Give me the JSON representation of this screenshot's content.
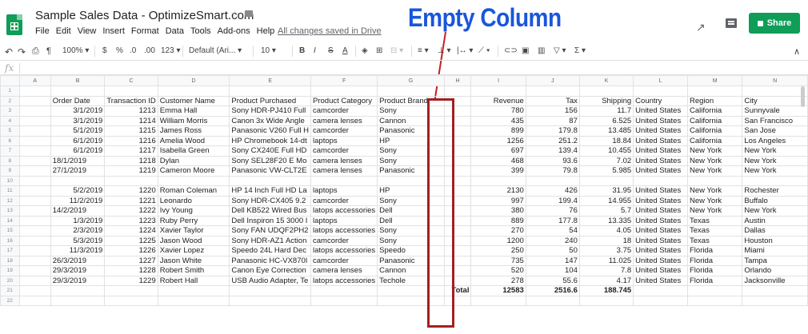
{
  "app": {
    "title": "Sample Sales Data - OptimizeSmart.com",
    "menu": [
      "File",
      "Edit",
      "View",
      "Insert",
      "Format",
      "Data",
      "Tools",
      "Add-ons",
      "Help"
    ],
    "saved_status": "All changes saved in Drive",
    "share_label": "Share",
    "annotation": "Empty Column"
  },
  "toolbar": {
    "zoom": "100%",
    "currency": "$",
    "percent": "%",
    "dec_less": ".0",
    "dec_more": ".00",
    "format": "123",
    "font": "Default (Ari...",
    "font_size": "10",
    "bold": "B",
    "italic": "I",
    "strike": "S",
    "underline": "A",
    "sigma": "Σ"
  },
  "formula_bar": {
    "fx": "fx",
    "value": ""
  },
  "grid": {
    "columns": [
      "A",
      "B",
      "C",
      "D",
      "E",
      "F",
      "G",
      "H",
      "I",
      "J",
      "K",
      "L",
      "M",
      "N"
    ],
    "rows": [
      [
        "",
        "",
        "",
        "",
        "",
        "",
        "",
        "",
        "",
        "",
        "",
        "",
        "",
        ""
      ],
      [
        "",
        "Order Date",
        "Transaction ID",
        "Customer Name",
        "Product Purchased",
        "Product Category",
        "Product Brand",
        "",
        "Revenue",
        "Tax",
        "Shipping",
        "Country",
        "Region",
        "City"
      ],
      [
        "",
        "3/1/2019",
        "1213",
        "Emma Hall",
        "Sony HDR-PJ410 Full",
        "camcorder",
        "Sony",
        "",
        "780",
        "156",
        "11.7",
        "United States",
        "California",
        "Sunnyvale"
      ],
      [
        "",
        "3/1/2019",
        "1214",
        "William Morris",
        "Canon 3x Wide Angle",
        "camera lenses",
        "Cannon",
        "",
        "435",
        "87",
        "6.525",
        "United States",
        "California",
        "San Francisco"
      ],
      [
        "",
        "5/1/2019",
        "1215",
        "James Ross",
        "Panasonic V260 Full H",
        "camcorder",
        "Panasonic",
        "",
        "899",
        "179.8",
        "13.485",
        "United States",
        "California",
        "San Jose"
      ],
      [
        "",
        "6/1/2019",
        "1216",
        "Amelia Wood",
        "HP Chromebook 14-dt",
        "laptops",
        "HP",
        "",
        "1256",
        "251.2",
        "18.84",
        "United States",
        "California",
        "Los Angeles"
      ],
      [
        "",
        "6/1/2019",
        "1217",
        "Isabella Green",
        "Sony CX240E Full HD",
        "camcorder",
        "Sony",
        "",
        "697",
        "139.4",
        "10.455",
        "United States",
        "New York",
        "New York"
      ],
      [
        "",
        "18/1/2019",
        "1218",
        "Dylan",
        "Sony SEL28F20 E Mo",
        "camera lenses",
        "Sony",
        "",
        "468",
        "93.6",
        "7.02",
        "United States",
        "New York",
        "New York"
      ],
      [
        "",
        "27/1/2019",
        "1219",
        "Cameron Moore",
        "Panasonic VW-CLT2E",
        "camera lenses",
        "Panasonic",
        "",
        "399",
        "79.8",
        "5.985",
        "United States",
        "New York",
        "New York"
      ],
      [
        "",
        "",
        "",
        "",
        "",
        "",
        "",
        "",
        "",
        "",
        "",
        "",
        "",
        ""
      ],
      [
        "",
        "5/2/2019",
        "1220",
        "Roman Coleman",
        "HP 14 Inch Full HD La",
        "laptops",
        "HP",
        "",
        "2130",
        "426",
        "31.95",
        "United States",
        "New York",
        "Rochester"
      ],
      [
        "",
        "11/2/2019",
        "1221",
        "Leonardo",
        "Sony HDR-CX405 9.2",
        "camcorder",
        "Sony",
        "",
        "997",
        "199.4",
        "14.955",
        "United States",
        "New York",
        "Buffalo"
      ],
      [
        "",
        "14/2/2019",
        "1222",
        "Ivy Young",
        "Dell KB522 Wired Bus",
        "latops accessories",
        "Dell",
        "",
        "380",
        "76",
        "5.7",
        "United States",
        "New York",
        "New York"
      ],
      [
        "",
        "1/3/2019",
        "1223",
        "Ruby Perry",
        "Dell Inspiron 15 3000 I",
        "laptops",
        "Dell",
        "",
        "889",
        "177.8",
        "13.335",
        "United States",
        "Texas",
        "Austin"
      ],
      [
        "",
        "2/3/2019",
        "1224",
        "Xavier Taylor",
        "Sony FAN UDQF2PH2",
        "latops accessories",
        "Sony",
        "",
        "270",
        "54",
        "4.05",
        "United States",
        "Texas",
        "Dallas"
      ],
      [
        "",
        "5/3/2019",
        "1225",
        "Jason Wood",
        "Sony HDR-AZ1 Action",
        "camcorder",
        "Sony",
        "",
        "1200",
        "240",
        "18",
        "United States",
        "Texas",
        "Houston"
      ],
      [
        "",
        "11/3/2019",
        "1226",
        "Xavier Lopez",
        "Speedo 24L Hard Dec",
        "latops accessories",
        "Speedo",
        "",
        "250",
        "50",
        "3.75",
        "United States",
        "Florida",
        "Miami"
      ],
      [
        "",
        "26/3/2019",
        "1227",
        "Jason White",
        "Panasonic HC-VX870I",
        "camcorder",
        "Panasonic",
        "",
        "735",
        "147",
        "11.025",
        "United States",
        "Florida",
        "Tampa"
      ],
      [
        "",
        "29/3/2019",
        "1228",
        "Robert Smith",
        "Canon Eye Correction",
        "camera lenses",
        "Cannon",
        "",
        "520",
        "104",
        "7.8",
        "United States",
        "Florida",
        "Orlando"
      ],
      [
        "",
        "29/3/2019",
        "1229",
        "Robert Hall",
        "USB Audio Adapter, Te",
        "latops accessories",
        "Techole",
        "",
        "278",
        "55.6",
        "4.17",
        "United States",
        "Florida",
        "Jacksonville"
      ],
      [
        "",
        "",
        "",
        "",
        "",
        "",
        "",
        "Total",
        "12583",
        "2516.6",
        "188.745",
        "",
        "",
        ""
      ],
      [
        "",
        "",
        "",
        "",
        "",
        "",
        "",
        "",
        "",
        "",
        "",
        "",
        "",
        ""
      ]
    ]
  }
}
